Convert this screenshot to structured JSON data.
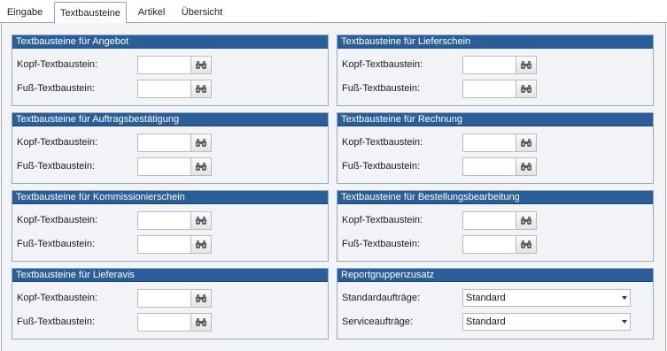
{
  "tabs": [
    {
      "label": "Eingabe"
    },
    {
      "label": "Textbausteine"
    },
    {
      "label": "Artikel"
    },
    {
      "label": "Übersicht"
    }
  ],
  "labels": {
    "kopf": "Kopf-Textbaustein:",
    "fuss": "Fuß-Textbaustein:"
  },
  "groups": {
    "angebot": {
      "title": "Textbausteine für Angebot"
    },
    "lieferschein": {
      "title": "Textbausteine für Lieferschein"
    },
    "auftragsbestaetigung": {
      "title": "Textbausteine für Auftragsbestätigung"
    },
    "rechnung": {
      "title": "Textbausteine für Rechnung"
    },
    "kommissionierschein": {
      "title": "Textbausteine für Kommissionierschein"
    },
    "bestellungsbearbeitung": {
      "title": "Textbausteine für Bestellungsbearbeitung"
    },
    "lieferavis": {
      "title": "Textbausteine für Lieferavis"
    },
    "report": {
      "title": "Reportgruppenzusatz",
      "standard_label": "Standardaufträge:",
      "standard_value": "Standard",
      "service_label": "Serviceaufträge:",
      "service_value": "Standard"
    }
  },
  "icons": {
    "lookup": "binoculars-icon",
    "dropdown": "chevron-down-icon"
  },
  "colors": {
    "header_bg": "#2a5e9b",
    "panel_bg": "#f2f3f6"
  }
}
